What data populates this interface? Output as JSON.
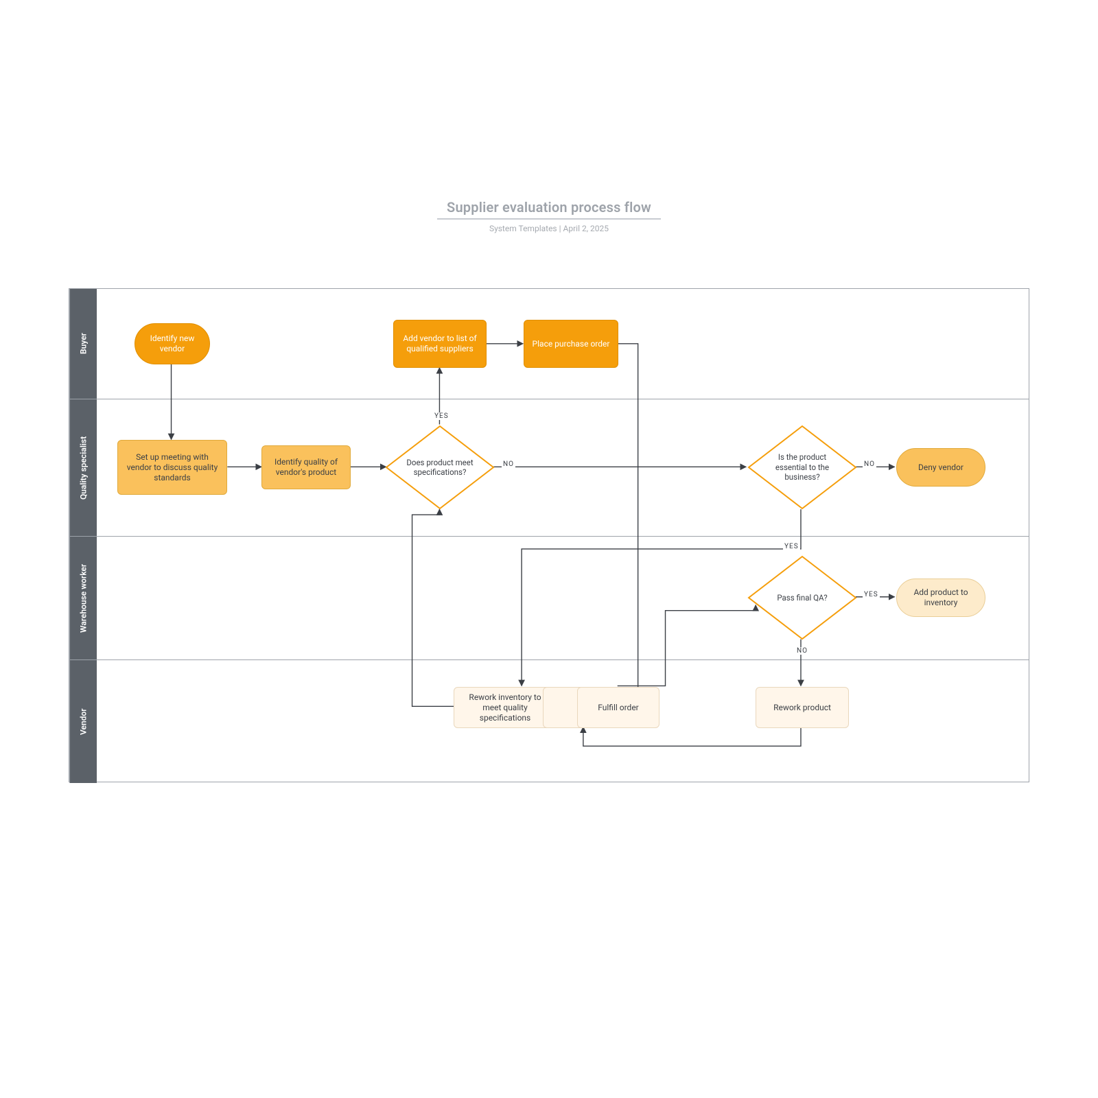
{
  "title": "Supplier evaluation process flow",
  "subtitle_author": "System Templates",
  "subtitle_sep": "|",
  "subtitle_date": "April 2, 2025",
  "lanes": {
    "buyer": "Buyer",
    "quality": "Quality specialist",
    "warehouse": "Warehouse worker",
    "vendor": "Vendor"
  },
  "nodes": {
    "identify_vendor": "Identify new vendor",
    "add_qualified": "Add vendor to list of qualified suppliers",
    "place_order": "Place purchase order",
    "meeting": "Set up meeting with vendor to discuss quality standards",
    "identify_quality": "Identify quality of vendor's product",
    "meets_spec": "Does product meet specifications?",
    "essential": "Is the product essential to the business?",
    "deny": "Deny vendor",
    "final_qa": "Pass final QA?",
    "add_inventory": "Add product to inventory",
    "rework_inventory": "Rework inventory to meet quality specifications",
    "fulfill": "Fulfill order",
    "rework_product": "Rework product"
  },
  "edges": {
    "yes": "YES",
    "no": "NO"
  },
  "colors": {
    "accent_dark": "#F59E0B",
    "accent_mid": "#FAC15C",
    "accent_light": "#FDEBCB",
    "accent_cream": "#FFF6EA",
    "lane_header": "#5B6168",
    "border": "#9EA3AA"
  }
}
